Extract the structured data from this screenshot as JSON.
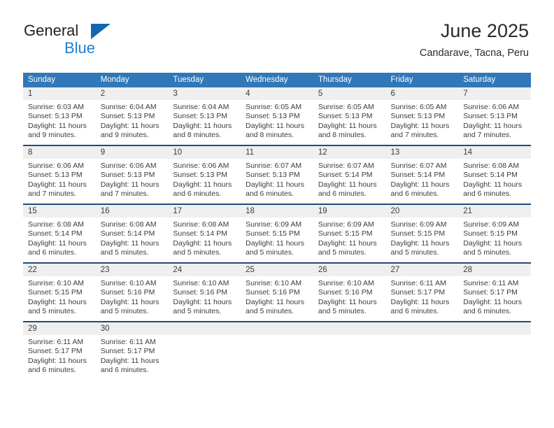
{
  "brand": {
    "name_top": "General",
    "name_bottom": "Blue",
    "logo_icon": "blue-triangle-icon"
  },
  "header": {
    "title": "June 2025",
    "subtitle": "Candarave, Tacna, Peru"
  },
  "colors": {
    "header_blue": "#3178b8",
    "week_separator": "#1b4e7e",
    "daynum_band": "#efefef",
    "brand_blue": "#1f7fd4",
    "text": "#3c3c3c"
  },
  "weekday_headers": [
    "Sunday",
    "Monday",
    "Tuesday",
    "Wednesday",
    "Thursday",
    "Friday",
    "Saturday"
  ],
  "weeks": [
    [
      {
        "day": "1",
        "sunrise": "Sunrise: 6:03 AM",
        "sunset": "Sunset: 5:13 PM",
        "daylight_1": "Daylight: 11 hours",
        "daylight_2": "and 9 minutes."
      },
      {
        "day": "2",
        "sunrise": "Sunrise: 6:04 AM",
        "sunset": "Sunset: 5:13 PM",
        "daylight_1": "Daylight: 11 hours",
        "daylight_2": "and 9 minutes."
      },
      {
        "day": "3",
        "sunrise": "Sunrise: 6:04 AM",
        "sunset": "Sunset: 5:13 PM",
        "daylight_1": "Daylight: 11 hours",
        "daylight_2": "and 8 minutes."
      },
      {
        "day": "4",
        "sunrise": "Sunrise: 6:05 AM",
        "sunset": "Sunset: 5:13 PM",
        "daylight_1": "Daylight: 11 hours",
        "daylight_2": "and 8 minutes."
      },
      {
        "day": "5",
        "sunrise": "Sunrise: 6:05 AM",
        "sunset": "Sunset: 5:13 PM",
        "daylight_1": "Daylight: 11 hours",
        "daylight_2": "and 8 minutes."
      },
      {
        "day": "6",
        "sunrise": "Sunrise: 6:05 AM",
        "sunset": "Sunset: 5:13 PM",
        "daylight_1": "Daylight: 11 hours",
        "daylight_2": "and 7 minutes."
      },
      {
        "day": "7",
        "sunrise": "Sunrise: 6:06 AM",
        "sunset": "Sunset: 5:13 PM",
        "daylight_1": "Daylight: 11 hours",
        "daylight_2": "and 7 minutes."
      }
    ],
    [
      {
        "day": "8",
        "sunrise": "Sunrise: 6:06 AM",
        "sunset": "Sunset: 5:13 PM",
        "daylight_1": "Daylight: 11 hours",
        "daylight_2": "and 7 minutes."
      },
      {
        "day": "9",
        "sunrise": "Sunrise: 6:06 AM",
        "sunset": "Sunset: 5:13 PM",
        "daylight_1": "Daylight: 11 hours",
        "daylight_2": "and 7 minutes."
      },
      {
        "day": "10",
        "sunrise": "Sunrise: 6:06 AM",
        "sunset": "Sunset: 5:13 PM",
        "daylight_1": "Daylight: 11 hours",
        "daylight_2": "and 6 minutes."
      },
      {
        "day": "11",
        "sunrise": "Sunrise: 6:07 AM",
        "sunset": "Sunset: 5:13 PM",
        "daylight_1": "Daylight: 11 hours",
        "daylight_2": "and 6 minutes."
      },
      {
        "day": "12",
        "sunrise": "Sunrise: 6:07 AM",
        "sunset": "Sunset: 5:14 PM",
        "daylight_1": "Daylight: 11 hours",
        "daylight_2": "and 6 minutes."
      },
      {
        "day": "13",
        "sunrise": "Sunrise: 6:07 AM",
        "sunset": "Sunset: 5:14 PM",
        "daylight_1": "Daylight: 11 hours",
        "daylight_2": "and 6 minutes."
      },
      {
        "day": "14",
        "sunrise": "Sunrise: 6:08 AM",
        "sunset": "Sunset: 5:14 PM",
        "daylight_1": "Daylight: 11 hours",
        "daylight_2": "and 6 minutes."
      }
    ],
    [
      {
        "day": "15",
        "sunrise": "Sunrise: 6:08 AM",
        "sunset": "Sunset: 5:14 PM",
        "daylight_1": "Daylight: 11 hours",
        "daylight_2": "and 6 minutes."
      },
      {
        "day": "16",
        "sunrise": "Sunrise: 6:08 AM",
        "sunset": "Sunset: 5:14 PM",
        "daylight_1": "Daylight: 11 hours",
        "daylight_2": "and 5 minutes."
      },
      {
        "day": "17",
        "sunrise": "Sunrise: 6:08 AM",
        "sunset": "Sunset: 5:14 PM",
        "daylight_1": "Daylight: 11 hours",
        "daylight_2": "and 5 minutes."
      },
      {
        "day": "18",
        "sunrise": "Sunrise: 6:09 AM",
        "sunset": "Sunset: 5:15 PM",
        "daylight_1": "Daylight: 11 hours",
        "daylight_2": "and 5 minutes."
      },
      {
        "day": "19",
        "sunrise": "Sunrise: 6:09 AM",
        "sunset": "Sunset: 5:15 PM",
        "daylight_1": "Daylight: 11 hours",
        "daylight_2": "and 5 minutes."
      },
      {
        "day": "20",
        "sunrise": "Sunrise: 6:09 AM",
        "sunset": "Sunset: 5:15 PM",
        "daylight_1": "Daylight: 11 hours",
        "daylight_2": "and 5 minutes."
      },
      {
        "day": "21",
        "sunrise": "Sunrise: 6:09 AM",
        "sunset": "Sunset: 5:15 PM",
        "daylight_1": "Daylight: 11 hours",
        "daylight_2": "and 5 minutes."
      }
    ],
    [
      {
        "day": "22",
        "sunrise": "Sunrise: 6:10 AM",
        "sunset": "Sunset: 5:15 PM",
        "daylight_1": "Daylight: 11 hours",
        "daylight_2": "and 5 minutes."
      },
      {
        "day": "23",
        "sunrise": "Sunrise: 6:10 AM",
        "sunset": "Sunset: 5:16 PM",
        "daylight_1": "Daylight: 11 hours",
        "daylight_2": "and 5 minutes."
      },
      {
        "day": "24",
        "sunrise": "Sunrise: 6:10 AM",
        "sunset": "Sunset: 5:16 PM",
        "daylight_1": "Daylight: 11 hours",
        "daylight_2": "and 5 minutes."
      },
      {
        "day": "25",
        "sunrise": "Sunrise: 6:10 AM",
        "sunset": "Sunset: 5:16 PM",
        "daylight_1": "Daylight: 11 hours",
        "daylight_2": "and 5 minutes."
      },
      {
        "day": "26",
        "sunrise": "Sunrise: 6:10 AM",
        "sunset": "Sunset: 5:16 PM",
        "daylight_1": "Daylight: 11 hours",
        "daylight_2": "and 5 minutes."
      },
      {
        "day": "27",
        "sunrise": "Sunrise: 6:11 AM",
        "sunset": "Sunset: 5:17 PM",
        "daylight_1": "Daylight: 11 hours",
        "daylight_2": "and 6 minutes."
      },
      {
        "day": "28",
        "sunrise": "Sunrise: 6:11 AM",
        "sunset": "Sunset: 5:17 PM",
        "daylight_1": "Daylight: 11 hours",
        "daylight_2": "and 6 minutes."
      }
    ],
    [
      {
        "day": "29",
        "sunrise": "Sunrise: 6:11 AM",
        "sunset": "Sunset: 5:17 PM",
        "daylight_1": "Daylight: 11 hours",
        "daylight_2": "and 6 minutes."
      },
      {
        "day": "30",
        "sunrise": "Sunrise: 6:11 AM",
        "sunset": "Sunset: 5:17 PM",
        "daylight_1": "Daylight: 11 hours",
        "daylight_2": "and 6 minutes."
      },
      {
        "day": "",
        "sunrise": "",
        "sunset": "",
        "daylight_1": "",
        "daylight_2": ""
      },
      {
        "day": "",
        "sunrise": "",
        "sunset": "",
        "daylight_1": "",
        "daylight_2": ""
      },
      {
        "day": "",
        "sunrise": "",
        "sunset": "",
        "daylight_1": "",
        "daylight_2": ""
      },
      {
        "day": "",
        "sunrise": "",
        "sunset": "",
        "daylight_1": "",
        "daylight_2": ""
      },
      {
        "day": "",
        "sunrise": "",
        "sunset": "",
        "daylight_1": "",
        "daylight_2": ""
      }
    ]
  ]
}
